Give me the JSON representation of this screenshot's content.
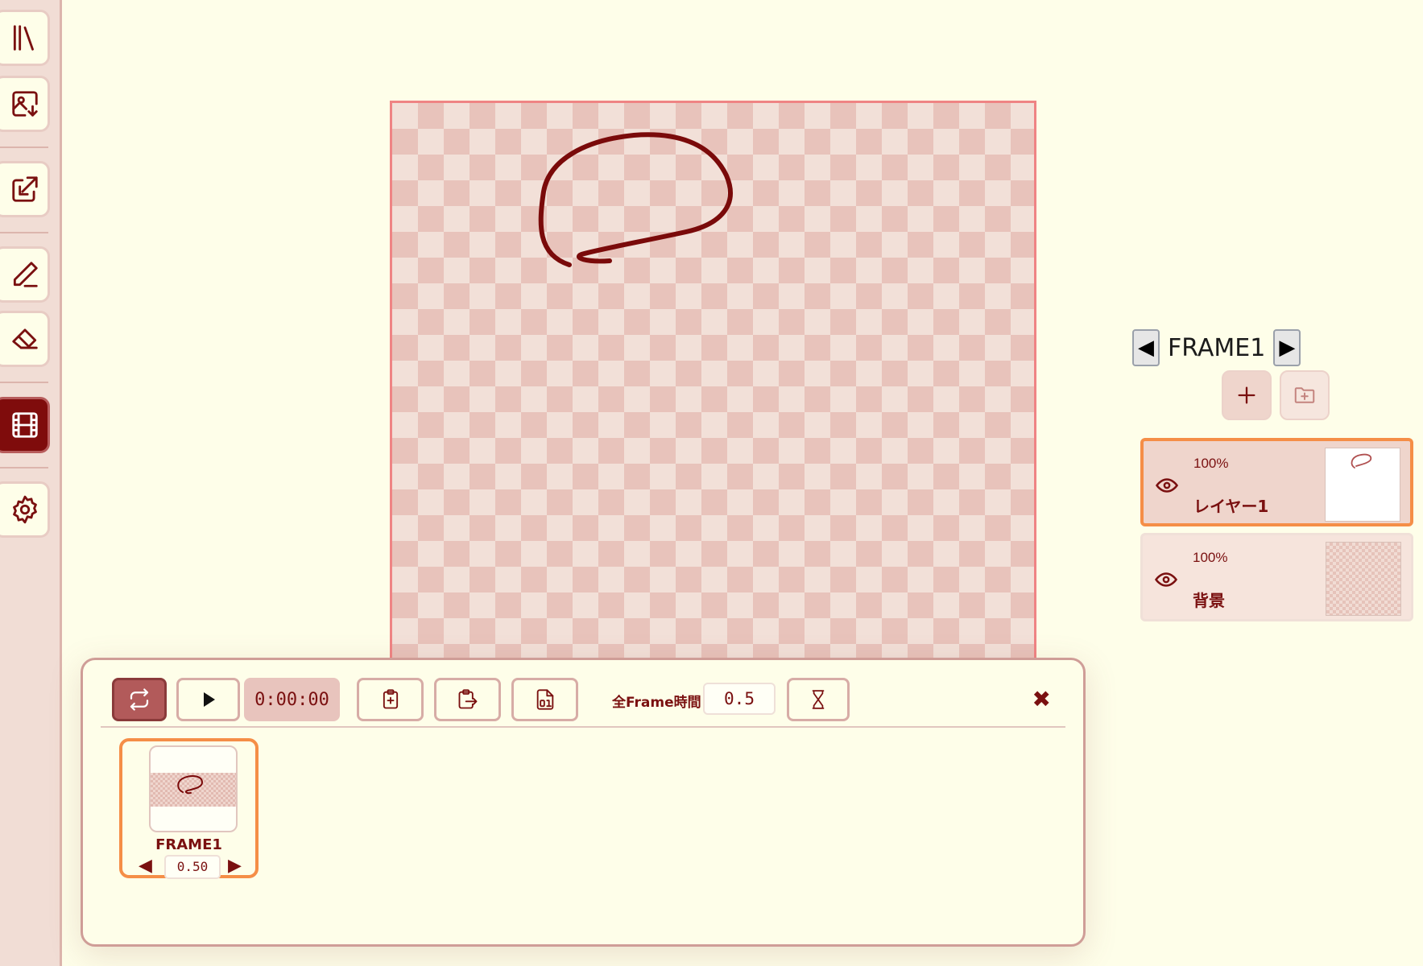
{
  "sidebar": {
    "tools": [
      {
        "name": "library-icon",
        "active": false
      },
      {
        "name": "import-image-icon",
        "active": false
      },
      {
        "name": "export-icon",
        "active": false
      },
      {
        "name": "pen-icon",
        "active": false
      },
      {
        "name": "eraser-icon",
        "active": false
      },
      {
        "name": "film-icon",
        "active": true
      },
      {
        "name": "gear-icon",
        "active": false
      }
    ]
  },
  "layer_panel": {
    "frame_title": "FRAME1",
    "prev_label": "◀",
    "next_label": "▶",
    "add_layer_icon": "plus-icon",
    "add_folder_icon": "folder-plus-icon",
    "layers": [
      {
        "opacity": "100%",
        "name": "レイヤー1",
        "selected": true
      },
      {
        "opacity": "100%",
        "name": "背景",
        "selected": false
      }
    ]
  },
  "animation": {
    "time_display": "0:00:00",
    "all_frame_label": "全Frame時間",
    "all_frame_value": "0.5",
    "close_label": "✖",
    "frames": [
      {
        "name": "FRAME1",
        "duration": "0.50"
      }
    ]
  },
  "colors": {
    "accent": "#7f0c0c",
    "selection": "#f58e47",
    "background": "#fefee9"
  }
}
